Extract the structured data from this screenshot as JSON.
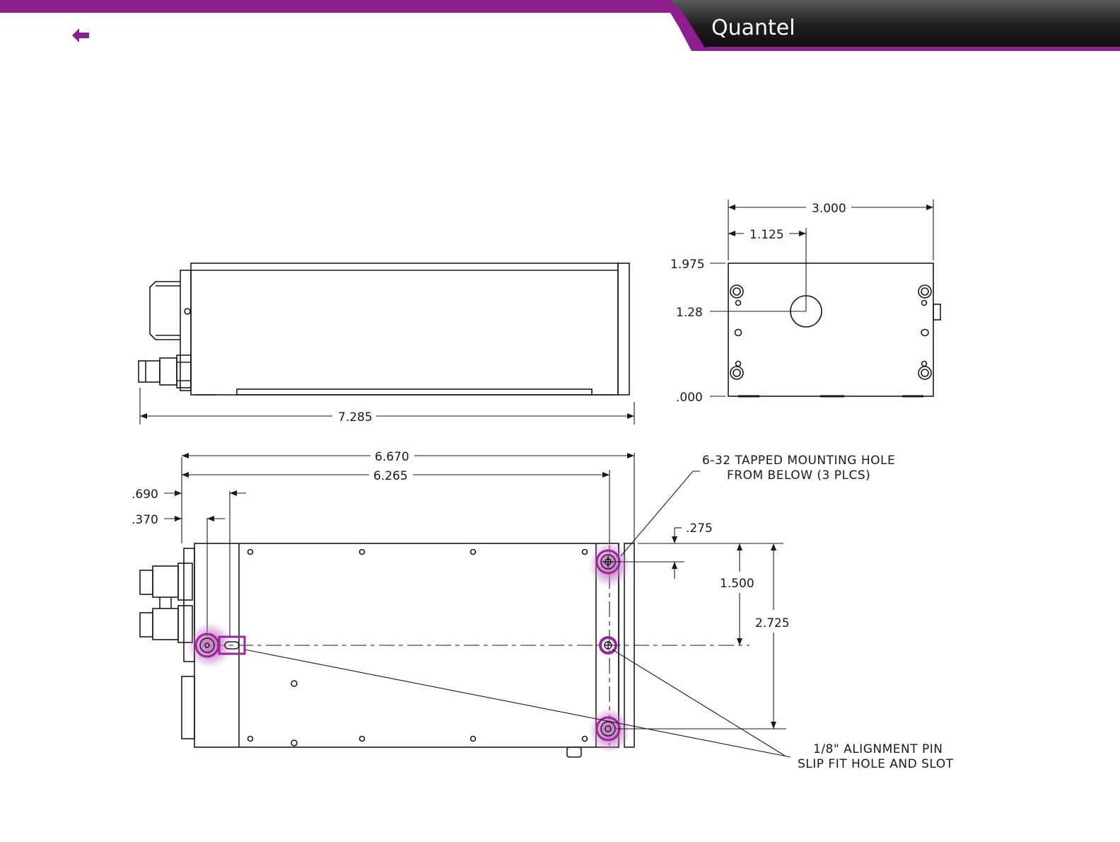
{
  "header": {
    "brand": "Quantel",
    "back_icon": "back-arrow-icon",
    "accent_color": "#8e1e8e",
    "bar_color": "#1c1c1c"
  },
  "side_view": {
    "overall_length": "7.285"
  },
  "end_view": {
    "width": "3.000",
    "center_offset": "1.125",
    "top_height": "1.975",
    "aperture_height": "1.28",
    "base_height": ".000"
  },
  "bottom_view": {
    "length_outer": "6.670",
    "length_inner": "6.265",
    "offset_690": ".690",
    "offset_370": ".370",
    "offset_275": ".275",
    "spacing_1500": "1.500",
    "spacing_2725": "2.725",
    "note_mounting_line1": "6-32 TAPPED MOUNTING HOLE",
    "note_mounting_line2": "FROM BELOW (3 PLCS)",
    "note_pin_line1": "1/8\" ALIGNMENT PIN",
    "note_pin_line2": "SLIP FIT HOLE AND SLOT",
    "highlight_color": "#a0209f"
  }
}
